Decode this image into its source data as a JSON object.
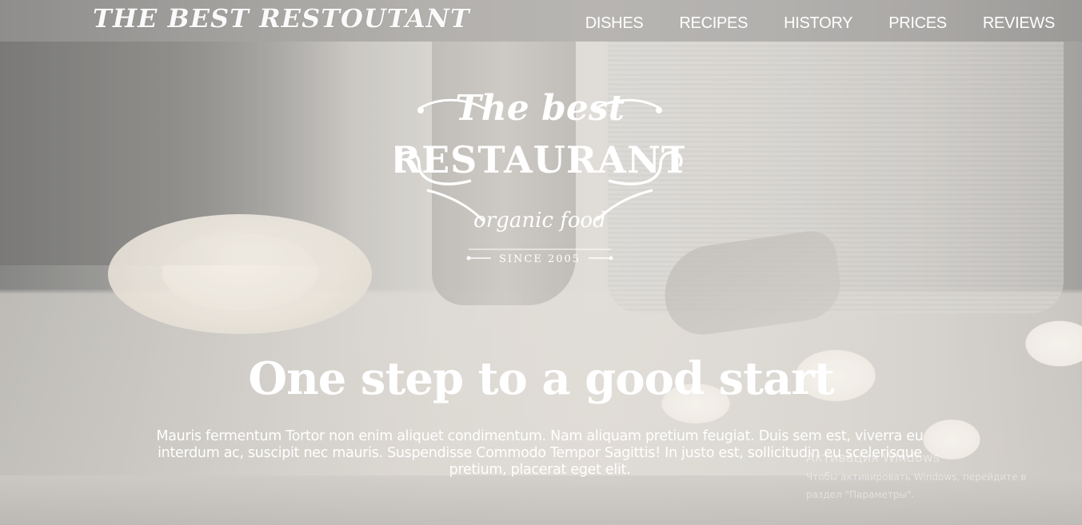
{
  "navbar": {
    "brand": "THE BEST RESTOUTANT",
    "items": [
      {
        "label": "DISHES"
      },
      {
        "label": "RECIPES"
      },
      {
        "label": "HISTORY"
      },
      {
        "label": "PRICES"
      },
      {
        "label": "REVIEWS"
      }
    ]
  },
  "logo": {
    "line1": "The best",
    "line2": "RESTAURANT",
    "line3": "organic food",
    "line4": "SINCE 2005"
  },
  "hero": {
    "headline": "One step to a good start",
    "lead": "Mauris fermentum Tortor non enim aliquet condimentum. Nam aliquam pretium feugiat. Duis sem est, viverra eu interdum ac, suscipit nec mauris. Suspendisse Commodo Tempor Sagittis! In justo est, sollicitudin eu scelerisque pretium, placerat eget elit."
  },
  "watermark": {
    "title": "Активация Windows",
    "text": "Чтобы активировать Windows, перейдите в раздел \"Параметры\"."
  }
}
